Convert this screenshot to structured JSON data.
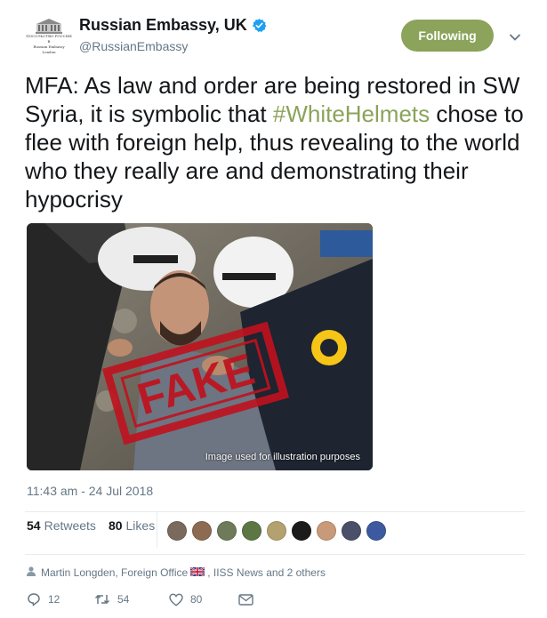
{
  "author": {
    "display_name": "Russian Embassy, UK",
    "handle": "@RussianEmbassy",
    "avatar_text": [
      "ПОСОЛЬСТВО РОССИИ",
      "В",
      "Russian Embassy",
      "London"
    ],
    "verified_icon": "verified-badge-icon"
  },
  "follow_button": {
    "label": "Following",
    "color": "#8ba35a"
  },
  "tweet": {
    "text_before": "MFA: As law and order are being restored in SW Syria, it is symbolic that ",
    "hashtag": "#WhiteHelmets",
    "text_after": " chose to flee with foreign help, thus revealing to the world who they really are and demonstrating their hypocrisy",
    "hashtag_color": "#8ba35a"
  },
  "media": {
    "stamp_text": "FAKE",
    "caption": "Image used for illustration purposes"
  },
  "timestamp": "11:43 am - 24 Jul 2018",
  "stats": {
    "retweets_count": "54",
    "retweets_label": "Retweets",
    "likes_count": "80",
    "likes_label": "Likes"
  },
  "liker_avatar_colors": [
    "#7a6a5e",
    "#8c6b52",
    "#6f7a5a",
    "#5d7744",
    "#b3a270",
    "#1b1b1b",
    "#c99a7a",
    "#4a4f6a",
    "#3d5aa0"
  ],
  "social_context": {
    "person_icon": "person-icon",
    "names_part1": "Martin Longden, Foreign Office",
    "flag_icon": "uk-flag-icon",
    "names_part2": ", IISS News and 2 others"
  },
  "actions": {
    "reply_count": "12",
    "retweet_count": "54",
    "like_count": "80"
  }
}
